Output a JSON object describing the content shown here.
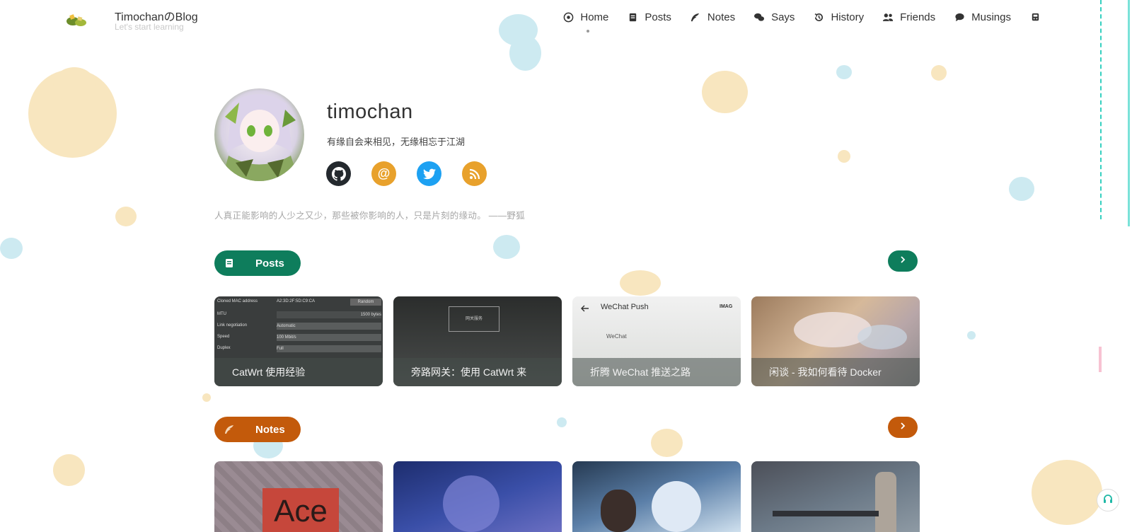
{
  "header": {
    "title": "TimochanのBlog",
    "subtitle": "Let's start learning",
    "nav": [
      {
        "label": "Home",
        "icon": "compass-icon"
      },
      {
        "label": "Posts",
        "icon": "book-icon"
      },
      {
        "label": "Notes",
        "icon": "feather-icon"
      },
      {
        "label": "Says",
        "icon": "chat-icon"
      },
      {
        "label": "History",
        "icon": "history-icon"
      },
      {
        "label": "Friends",
        "icon": "users-icon"
      },
      {
        "label": "Musings",
        "icon": "comment-icon"
      },
      {
        "label": "",
        "icon": "subway-icon"
      }
    ]
  },
  "profile": {
    "name": "timochan",
    "motto": "有缘自会来相见，无缘相忘于江湖",
    "socials": [
      {
        "icon": "github-icon",
        "color": "#24292e"
      },
      {
        "icon": "at-email-icon",
        "color": "#e8a12c"
      },
      {
        "icon": "twitter-icon",
        "color": "#1da1f2"
      },
      {
        "icon": "rss-icon",
        "color": "#e8a12c"
      }
    ],
    "quote": "人真正能影响的人少之又少，那些被你影响的人，只是片刻的缘动。 ——野狐"
  },
  "posts_section": {
    "label": "Posts",
    "color": "#0e7d5c",
    "cards": [
      {
        "title": "CatWrt 使用经验"
      },
      {
        "title": "旁路网关：使用 CatWrt 来"
      },
      {
        "title": "折腾 WeChat 推送之路"
      },
      {
        "title": "闲谈 - 我如何看待 Docker"
      }
    ]
  },
  "notes_section": {
    "label": "Notes",
    "color": "#c35a0b",
    "card_texts": [
      "Ace"
    ]
  },
  "card_screens": {
    "mac_label": "Cloned MAC address",
    "mac_value": "A2:3D:2F:5D:C9:CA",
    "mac_btn": "Random",
    "mtu_label": "MTU",
    "mtu_value": "1500 bytes",
    "link_label": "Link negotiation",
    "link_value": "Automatic",
    "speed_label": "Speed",
    "speed_value": "100 Mbit/s",
    "duplex_label": "Duplex",
    "duplex_value": "Full",
    "wechat_push": "WeChat Push",
    "wechat_tag": "IMAG",
    "wechat_item": "WeChat",
    "net_box": "网关服务"
  }
}
